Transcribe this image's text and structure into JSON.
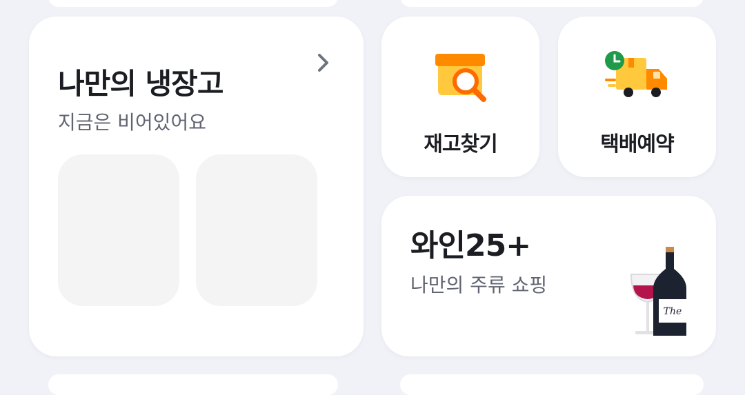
{
  "fridge": {
    "title": "나만의 냉장고",
    "subtitle": "지금은 비어있어요"
  },
  "shortcuts": [
    {
      "label": "재고찾기",
      "icon": "box-search-icon"
    },
    {
      "label": "택배예약",
      "icon": "delivery-truck-icon"
    }
  ],
  "wine": {
    "title": "와인25+",
    "subtitle": "나만의 주류 쇼핑",
    "icon": "wine-bottle-glass-icon",
    "bottle_label": "The"
  },
  "colors": {
    "background": "#f1f2f7",
    "card": "#ffffff",
    "accent_orange": "#ff8a00",
    "accent_yellow": "#ffc83d",
    "clock_green": "#1f9a4b",
    "wine_red": "#b3144b",
    "bottle": "#1c2230"
  }
}
